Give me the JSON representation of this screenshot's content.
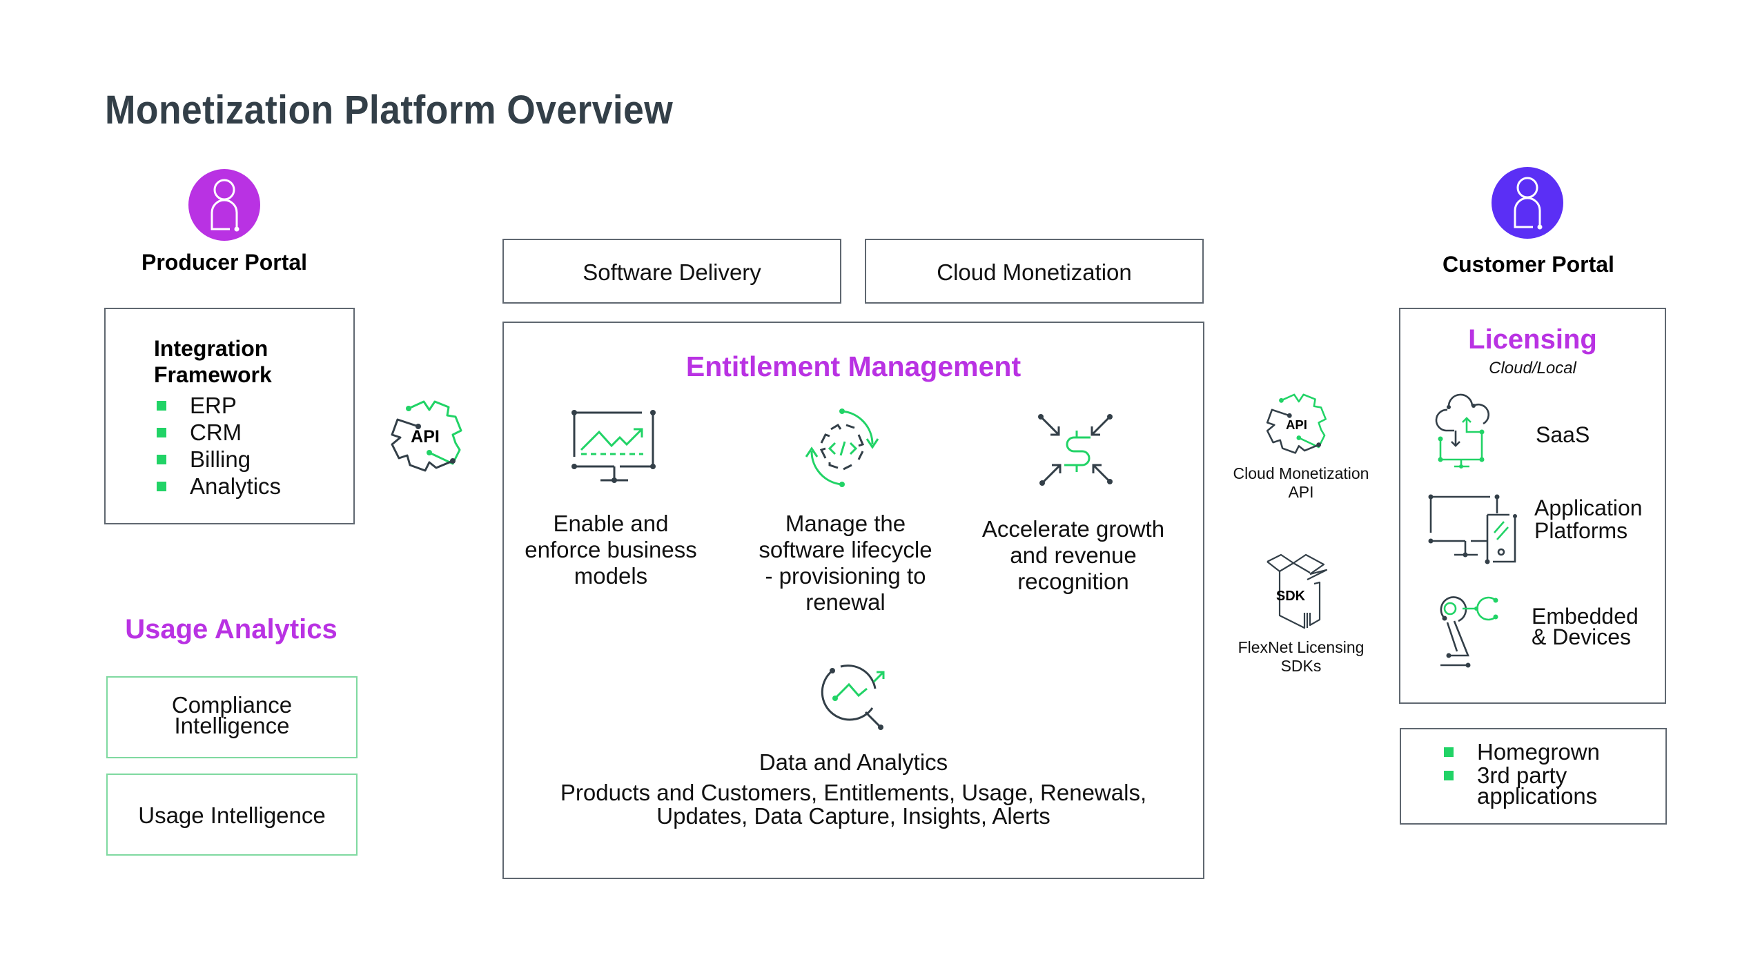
{
  "page": {
    "title": "Monetization Platform Overview"
  },
  "colors": {
    "producer_purple": "#b932e3",
    "customer_violet": "#5b2ff5",
    "accent_green": "#21d366",
    "icon_dark": "#333f48",
    "heading_purple": "#b932e3"
  },
  "producer_portal": {
    "label": "Producer Portal",
    "icon": "user-icon",
    "integration_framework": {
      "heading_line1": "Integration",
      "heading_line2": "Framework",
      "items": [
        "ERP",
        "CRM",
        "Billing",
        "Analytics"
      ]
    },
    "api_badge": "API"
  },
  "usage_analytics": {
    "heading": "Usage Analytics",
    "boxes": [
      {
        "line1": "Compliance",
        "line2": "Intelligence"
      },
      {
        "line1": "Usage Intelligence"
      }
    ]
  },
  "top_boxes": {
    "software_delivery": "Software Delivery",
    "cloud_monetization": "Cloud Monetization"
  },
  "entitlement_management": {
    "heading": "Entitlement Management",
    "pillars": [
      {
        "icon": "monitor-chart-icon",
        "lines": [
          "Enable and",
          "enforce business",
          "models"
        ]
      },
      {
        "icon": "lifecycle-code-icon",
        "lines": [
          "Manage the",
          "software lifecycle",
          "- provisioning to",
          "renewal"
        ]
      },
      {
        "icon": "revenue-dollar-icon",
        "lines": [
          "Accelerate growth",
          "and revenue",
          "recognition"
        ]
      }
    ],
    "data_analytics": {
      "icon": "magnifier-chart-icon",
      "heading": "Data and Analytics",
      "line1": "Products and Customers, Entitlements, Usage, Renewals,",
      "line2": "Updates, Data Capture, Insights, Alerts"
    }
  },
  "connectors": {
    "cloud_api": {
      "badge": "API",
      "line1": "Cloud Monetization",
      "line2": "API"
    },
    "sdk": {
      "badge": "SDK",
      "line1": "FlexNet Licensing",
      "line2": "SDKs"
    }
  },
  "customer_portal": {
    "label": "Customer Portal",
    "icon": "user-icon",
    "licensing": {
      "heading": "Licensing",
      "subheading": "Cloud/Local",
      "items": [
        {
          "icon": "cloud-transfer-icon",
          "lines": [
            "SaaS"
          ]
        },
        {
          "icon": "devices-icon",
          "lines": [
            "Application",
            "Platforms"
          ]
        },
        {
          "icon": "robot-arm-icon",
          "lines": [
            "Embedded",
            "& Devices"
          ]
        }
      ]
    },
    "apps": {
      "items": [
        {
          "lines": [
            "Homegrown"
          ]
        },
        {
          "lines": [
            "3rd party",
            "applications"
          ]
        }
      ]
    }
  }
}
